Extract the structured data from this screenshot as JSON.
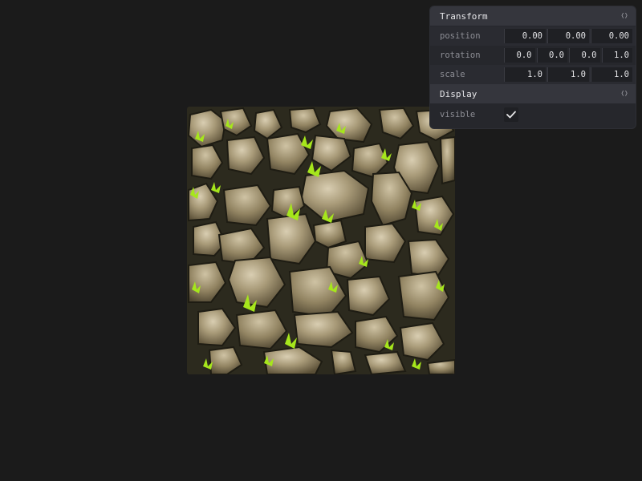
{
  "panel": {
    "transform": {
      "title": "Transform",
      "rows": [
        {
          "label": "position",
          "values": [
            "0.00",
            "0.00",
            "0.00"
          ]
        },
        {
          "label": "rotation",
          "values": [
            "0.0",
            "0.0",
            "0.0",
            "1.0"
          ]
        },
        {
          "label": "scale",
          "values": [
            "1.0",
            "1.0",
            "1.0"
          ]
        }
      ]
    },
    "display": {
      "title": "Display",
      "visible_label": "visible",
      "visible_checked": true
    }
  },
  "icons": {
    "collapse": "collapse-toggle-icon",
    "check": "checkmark-icon"
  },
  "viewport": {
    "image": "mossy-cobblestone-texture"
  }
}
